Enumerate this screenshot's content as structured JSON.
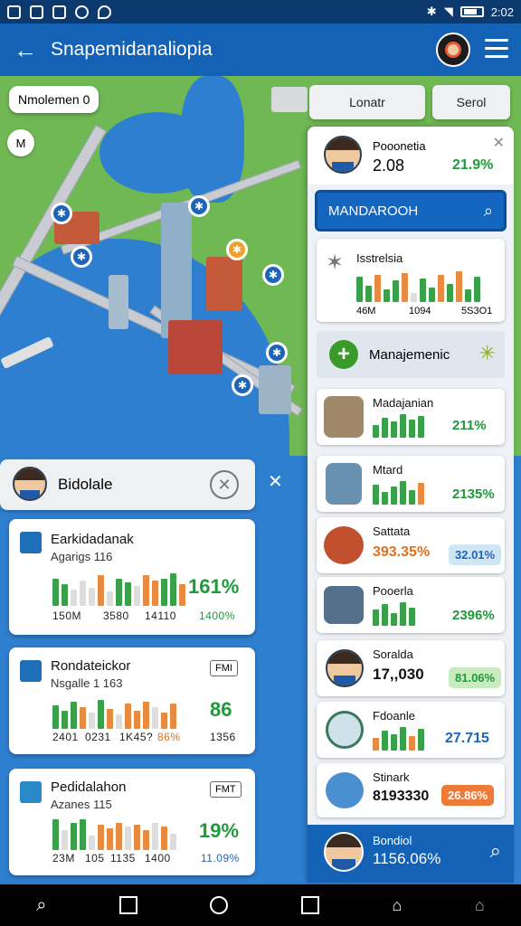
{
  "status_bar": {
    "time": "2:02"
  },
  "app_bar": {
    "title": "Snapemidanaliopia"
  },
  "map": {
    "label": "Nmolemen 0",
    "small_icon_text": "M"
  },
  "tabs": [
    {
      "label": "Lonatr"
    },
    {
      "label": "Serol"
    }
  ],
  "right_panel": {
    "profile": {
      "name": "Pooonetia",
      "value": "2.08",
      "percent": "21.9%"
    },
    "search": {
      "label": "MANDAROOH"
    },
    "chart_card": {
      "title": "Isstrelsia",
      "footer": [
        "46M",
        "1094",
        "5S3O1"
      ]
    },
    "management": {
      "label": "Manajemenic"
    },
    "items": [
      {
        "name": "Madajanian",
        "value": "211%",
        "value_color": "#1e9a3a"
      },
      {
        "name": "Mtard",
        "value": "2135%",
        "value_color": "#1e9a3a"
      },
      {
        "name": "Sattata",
        "value": "393.35%",
        "badge": "32.01%",
        "value_color": "#e07020"
      },
      {
        "name": "Pooerla",
        "value": "2396%",
        "value_color": "#1e9a3a"
      },
      {
        "name": "Soralda",
        "value": "17,,030",
        "badge": "81.06%",
        "value_color": "#111111"
      },
      {
        "name": "Fdoanle",
        "value": "27.715",
        "value_color": "#1e64b8"
      },
      {
        "name": "Stinark",
        "value": "8193330",
        "badge": "26.86%",
        "value_color": "#111111"
      }
    ],
    "bottom": {
      "name": "Bondiol",
      "value": "1156.06%"
    }
  },
  "left_panel": {
    "header": {
      "title": "Bidolale"
    },
    "cards": [
      {
        "title": "Earkidadanak",
        "subtitle": "Agarigs 116",
        "percent": "161%",
        "footer": [
          "150M",
          "3580",
          "14110"
        ],
        "footer_pct": "1400%"
      },
      {
        "title": "Rondateickor",
        "subtitle": "Nsgalle 1 163",
        "tag": "FMI",
        "percent": "86",
        "footer": [
          "2401",
          "0231",
          "1K45?"
        ],
        "footer_pct": "86%",
        "footer_right": "1356"
      },
      {
        "title": "Pedidalahon",
        "subtitle": "Azanes 115",
        "tag": "FMT",
        "percent": "19%",
        "footer": [
          "23M",
          "105",
          "1135",
          "1400"
        ],
        "footer_right": "11.09%"
      }
    ]
  },
  "colors": {
    "primary": "#1462b6",
    "green": "#1e9a3a",
    "orange": "#e07020"
  }
}
